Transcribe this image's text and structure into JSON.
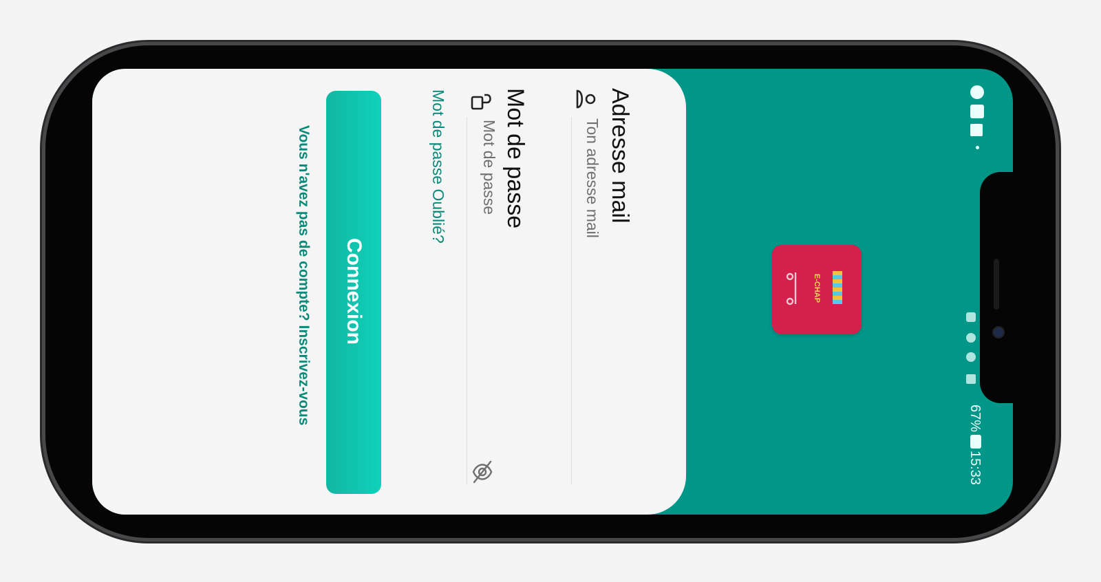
{
  "login": {
    "email_label": "Adresse mail",
    "email_placeholder": "Ton adresse mail",
    "password_label": "Mot de passe",
    "password_placeholder": "Mot de passe",
    "forgot_password": "Mot de passe Oublié?",
    "submit_label": "Connexion",
    "signup_prompt": "Vous n'avez pas de compte? Inscrivez-vous"
  },
  "logo": {
    "name": "E-CHAP",
    "icon": "shop-awning-logo",
    "background": "#d3204d"
  },
  "status_bar": {
    "time": "15:33",
    "battery": "67%"
  },
  "colors": {
    "primary": "#009688",
    "button_start": "#12b7a2",
    "button_end": "#0fd1bb",
    "link": "#0b8a7a",
    "card": "#f5f5f5"
  }
}
